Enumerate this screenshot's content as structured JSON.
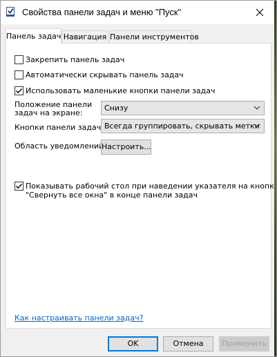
{
  "window": {
    "title": "Свойства панели задач и меню \"Пуск\""
  },
  "tabs": [
    {
      "label": "Панель задач",
      "active": true
    },
    {
      "label": "Навигация",
      "active": false
    },
    {
      "label": "Панели инструментов",
      "active": false
    }
  ],
  "options": {
    "lock_taskbar": {
      "label": "Закрепить панель задач",
      "checked": false
    },
    "autohide_taskbar": {
      "label": "Автоматически скрывать панель задач",
      "checked": false
    },
    "small_buttons": {
      "label": "Использовать маленькие кнопки панели задач",
      "checked": true
    },
    "peek_desktop": {
      "label_line1": "Показывать рабочий стол при наведении указателя на кнопку",
      "label_line2": "\"Свернуть все окна\" в конце панели задач",
      "checked": true
    }
  },
  "position": {
    "label_line1": "Положение панели",
    "label_line2": "задач на экране:",
    "value": "Снизу"
  },
  "buttons_grouping": {
    "label": "Кнопки панели задач:",
    "value": "Всегда группировать, скрывать метки"
  },
  "notification_area": {
    "label": "Область уведомлений:",
    "button": "Настроить..."
  },
  "help_link": "Как настраивать панели задач?",
  "footer": {
    "ok": "OK",
    "cancel": "Отмена",
    "apply": "Применить"
  },
  "colors": {
    "accent": "#0078d7",
    "link": "#0066cc",
    "check": "#000000"
  }
}
